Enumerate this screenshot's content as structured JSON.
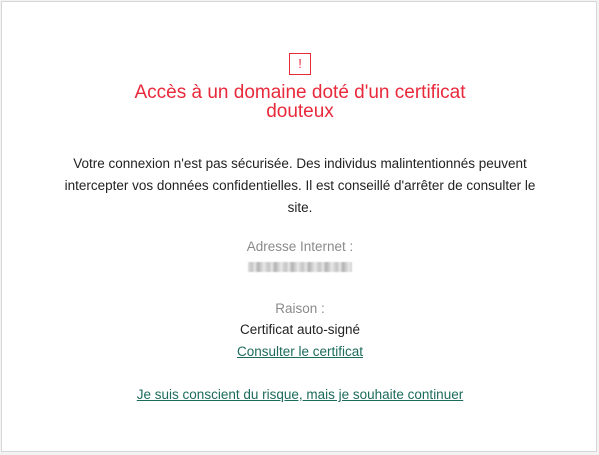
{
  "icon": {
    "name": "warning-icon",
    "glyph": "!",
    "color": "#e52a3a"
  },
  "title": "Accès à un domaine doté d'un certificat douteux",
  "message": "Votre connexion n'est pas sécurisée. Des individus malintentionnés peuvent intercepter vos données confidentielles. Il est conseillé d'arrêter de consulter le site.",
  "url": {
    "label": "Adresse Internet :"
  },
  "reason": {
    "label": "Raison :",
    "value": "Certificat auto-signé"
  },
  "links": {
    "view_certificate": "Consulter le certificat",
    "continue": "Je suis conscient du risque, mais je souhaite continuer"
  },
  "colors": {
    "title": "#e8293b",
    "link": "#1c6b5c",
    "label": "#8a8a8a"
  }
}
